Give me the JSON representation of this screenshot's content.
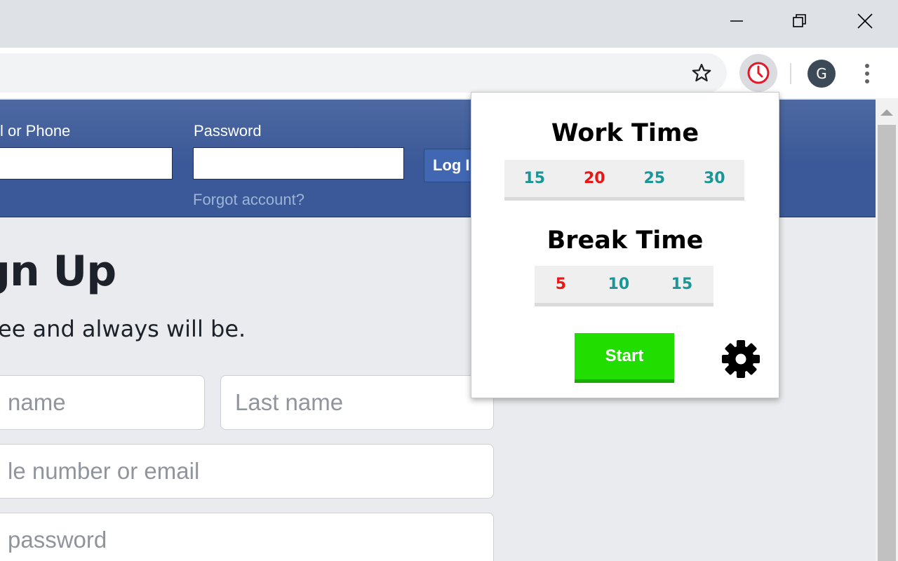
{
  "browser": {
    "window_controls": {
      "minimize": "minimize-icon",
      "restore": "restore-icon",
      "close": "close-icon"
    },
    "avatar_letter": "G"
  },
  "facebook": {
    "header": {
      "email_label": "l or Phone",
      "password_label": "Password",
      "login_button": "Log I",
      "forgot_link": "Forgot account?"
    },
    "signup": {
      "title": "gn Up",
      "subtitle": "ee and always will be.",
      "first_name_placeholder": "name",
      "last_name_placeholder": "Last name",
      "mobile_placeholder": "le number or email",
      "password_placeholder": " password"
    }
  },
  "popup": {
    "work_title": "Work Time",
    "work_options": [
      {
        "label": "15",
        "color": "#1a9696"
      },
      {
        "label": "20",
        "color": "#ec1515"
      },
      {
        "label": "25",
        "color": "#1a9696"
      },
      {
        "label": "30",
        "color": "#1a9696"
      }
    ],
    "break_title": "Break Time",
    "break_options": [
      {
        "label": "5",
        "color": "#ec1515"
      },
      {
        "label": "10",
        "color": "#1a9696"
      },
      {
        "label": "15",
        "color": "#1a9696"
      }
    ],
    "start_label": "Start",
    "settings_icon": "gear-icon"
  },
  "colors": {
    "selected": "#ec1515",
    "unselected": "#1a9696",
    "start": "#21dd00",
    "facebook_blue": "#3b5998"
  }
}
